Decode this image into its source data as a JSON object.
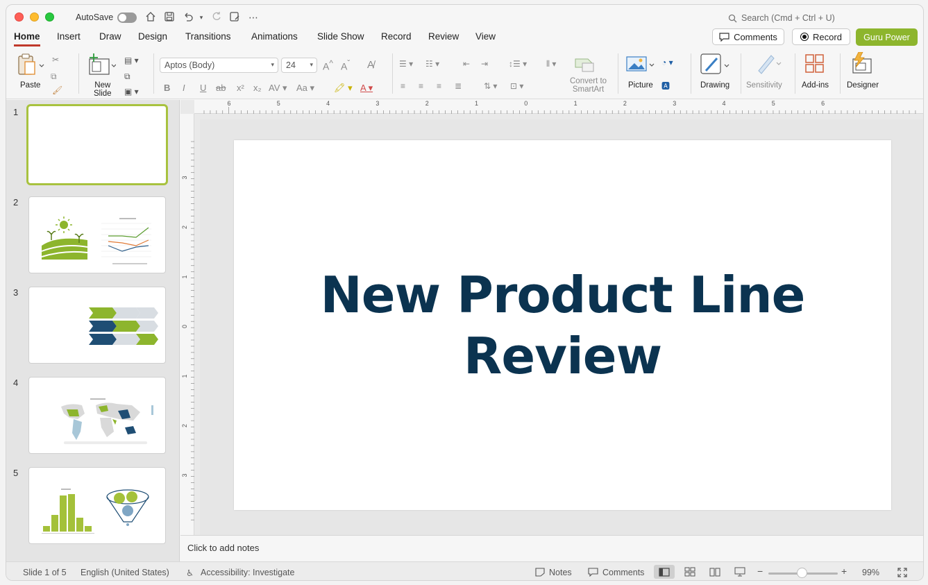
{
  "titlebar": {
    "autosave_label": "AutoSave",
    "search_placeholder": "Search (Cmd + Ctrl + U)"
  },
  "tabs": [
    "Home",
    "Insert",
    "Draw",
    "Design",
    "Transitions",
    "Animations",
    "Slide Show",
    "Record",
    "Review",
    "View"
  ],
  "active_tab": "Home",
  "header_buttons": {
    "comments": "Comments",
    "record": "Record",
    "guru": "Guru Power"
  },
  "ribbon": {
    "paste": "Paste",
    "new_slide": [
      "New",
      "Slide"
    ],
    "font_name": "Aptos (Body)",
    "font_size": "24",
    "convert_smartart": [
      "Convert to",
      "SmartArt"
    ],
    "picture": "Picture",
    "drawing": "Drawing",
    "sensitivity": "Sensitivity",
    "addins": "Add-ins",
    "designer": "Designer"
  },
  "thumbnails": [
    {
      "num": "1",
      "selected": true
    },
    {
      "num": "2",
      "selected": false
    },
    {
      "num": "3",
      "selected": false
    },
    {
      "num": "4",
      "selected": false
    },
    {
      "num": "5",
      "selected": false
    }
  ],
  "slide": {
    "title_line1": "New Product Line",
    "title_line2": "Review"
  },
  "notes_placeholder": "Click to add notes",
  "statusbar": {
    "slide_pos": "Slide 1 of 5",
    "language": "English (United States)",
    "accessibility": "Accessibility: Investigate",
    "notes": "Notes",
    "comments": "Comments",
    "zoom": "99%"
  },
  "ruler": {
    "h_labels": [
      "6",
      "5",
      "4",
      "3",
      "2",
      "1",
      "0",
      "1",
      "2",
      "3",
      "4",
      "5",
      "6"
    ],
    "v_labels": [
      "3",
      "2",
      "1",
      "0",
      "1",
      "2",
      "3"
    ]
  },
  "colors": {
    "accent_green": "#8db52d",
    "title_navy": "#0b3350",
    "tab_underline": "#c0392b"
  }
}
